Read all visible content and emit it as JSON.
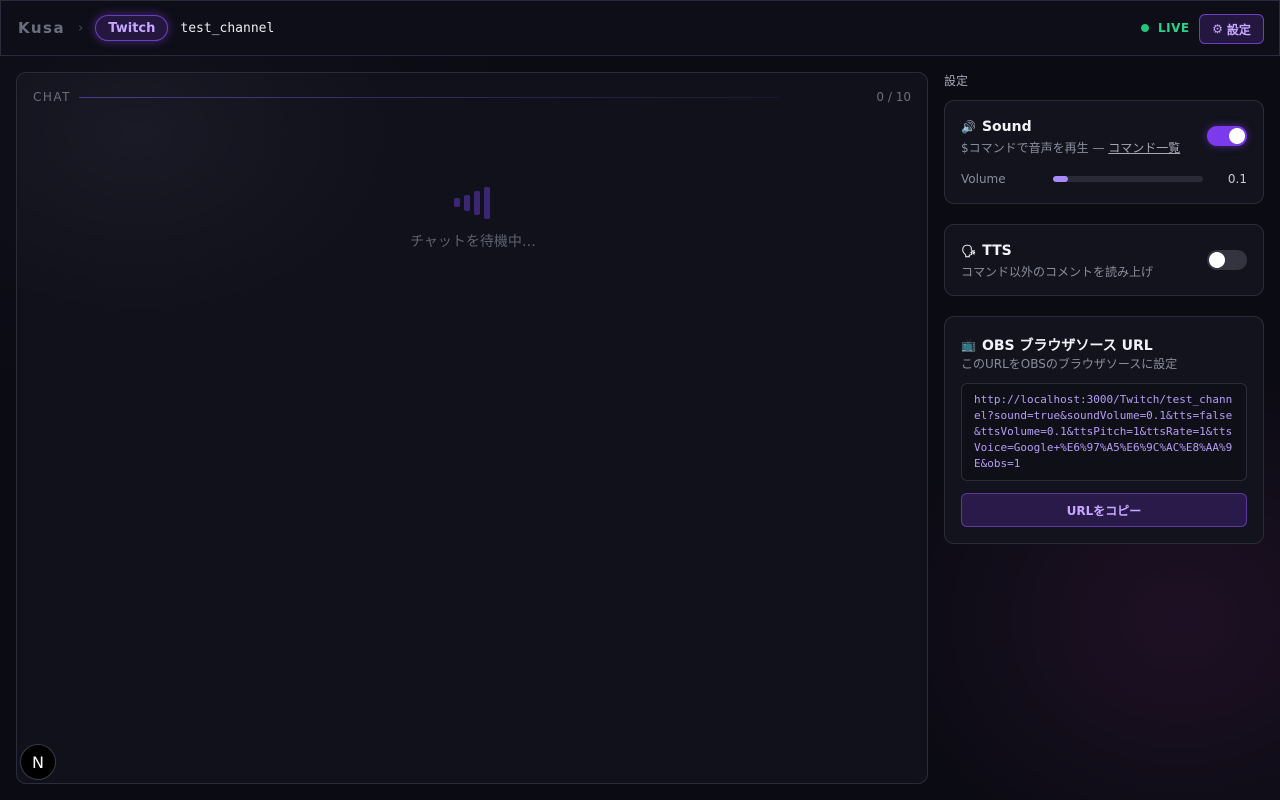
{
  "header": {
    "brand": "Kusa",
    "separator": "›",
    "platform": "Twitch",
    "channel": "test_channel",
    "live_label": "LIVE",
    "settings_icon": "⚙",
    "settings_label": "設定"
  },
  "chat": {
    "title": "CHAT",
    "count": "0 / 10",
    "waiting_text": "チャットを待機中…",
    "icon": "sound-wave-icon"
  },
  "settings": {
    "heading": "設定",
    "sound": {
      "icon": "🔊",
      "title": "Sound",
      "subtitle_prefix": "$コマンドで音声を再生 — ",
      "link": "コマンド一覧",
      "enabled": true,
      "volume_label": "Volume",
      "volume_value": "0.1",
      "volume": 0.1
    },
    "tts": {
      "icon": "🗣",
      "title": "TTS",
      "subtitle": "コマンド以外のコメントを読み上げ",
      "enabled": false
    },
    "obs": {
      "icon": "📺",
      "title": "OBS ブラウザソース URL",
      "subtitle": "このURLをOBSのブラウザソースに設定",
      "url": "http://localhost:3000/Twitch/test_channel?sound=true&soundVolume=0.1&tts=false&ttsVolume=0.1&ttsPitch=1&ttsRate=1&ttsVoice=Google+%E6%97%A5%E6%9C%AC%E8%AA%9E&obs=1",
      "copy_label": "URLをコピー"
    }
  },
  "badge": {
    "letter": "N"
  },
  "colors": {
    "accent": "#7c3aed",
    "accent_text": "#c7a6ff",
    "live": "#22c57a"
  }
}
